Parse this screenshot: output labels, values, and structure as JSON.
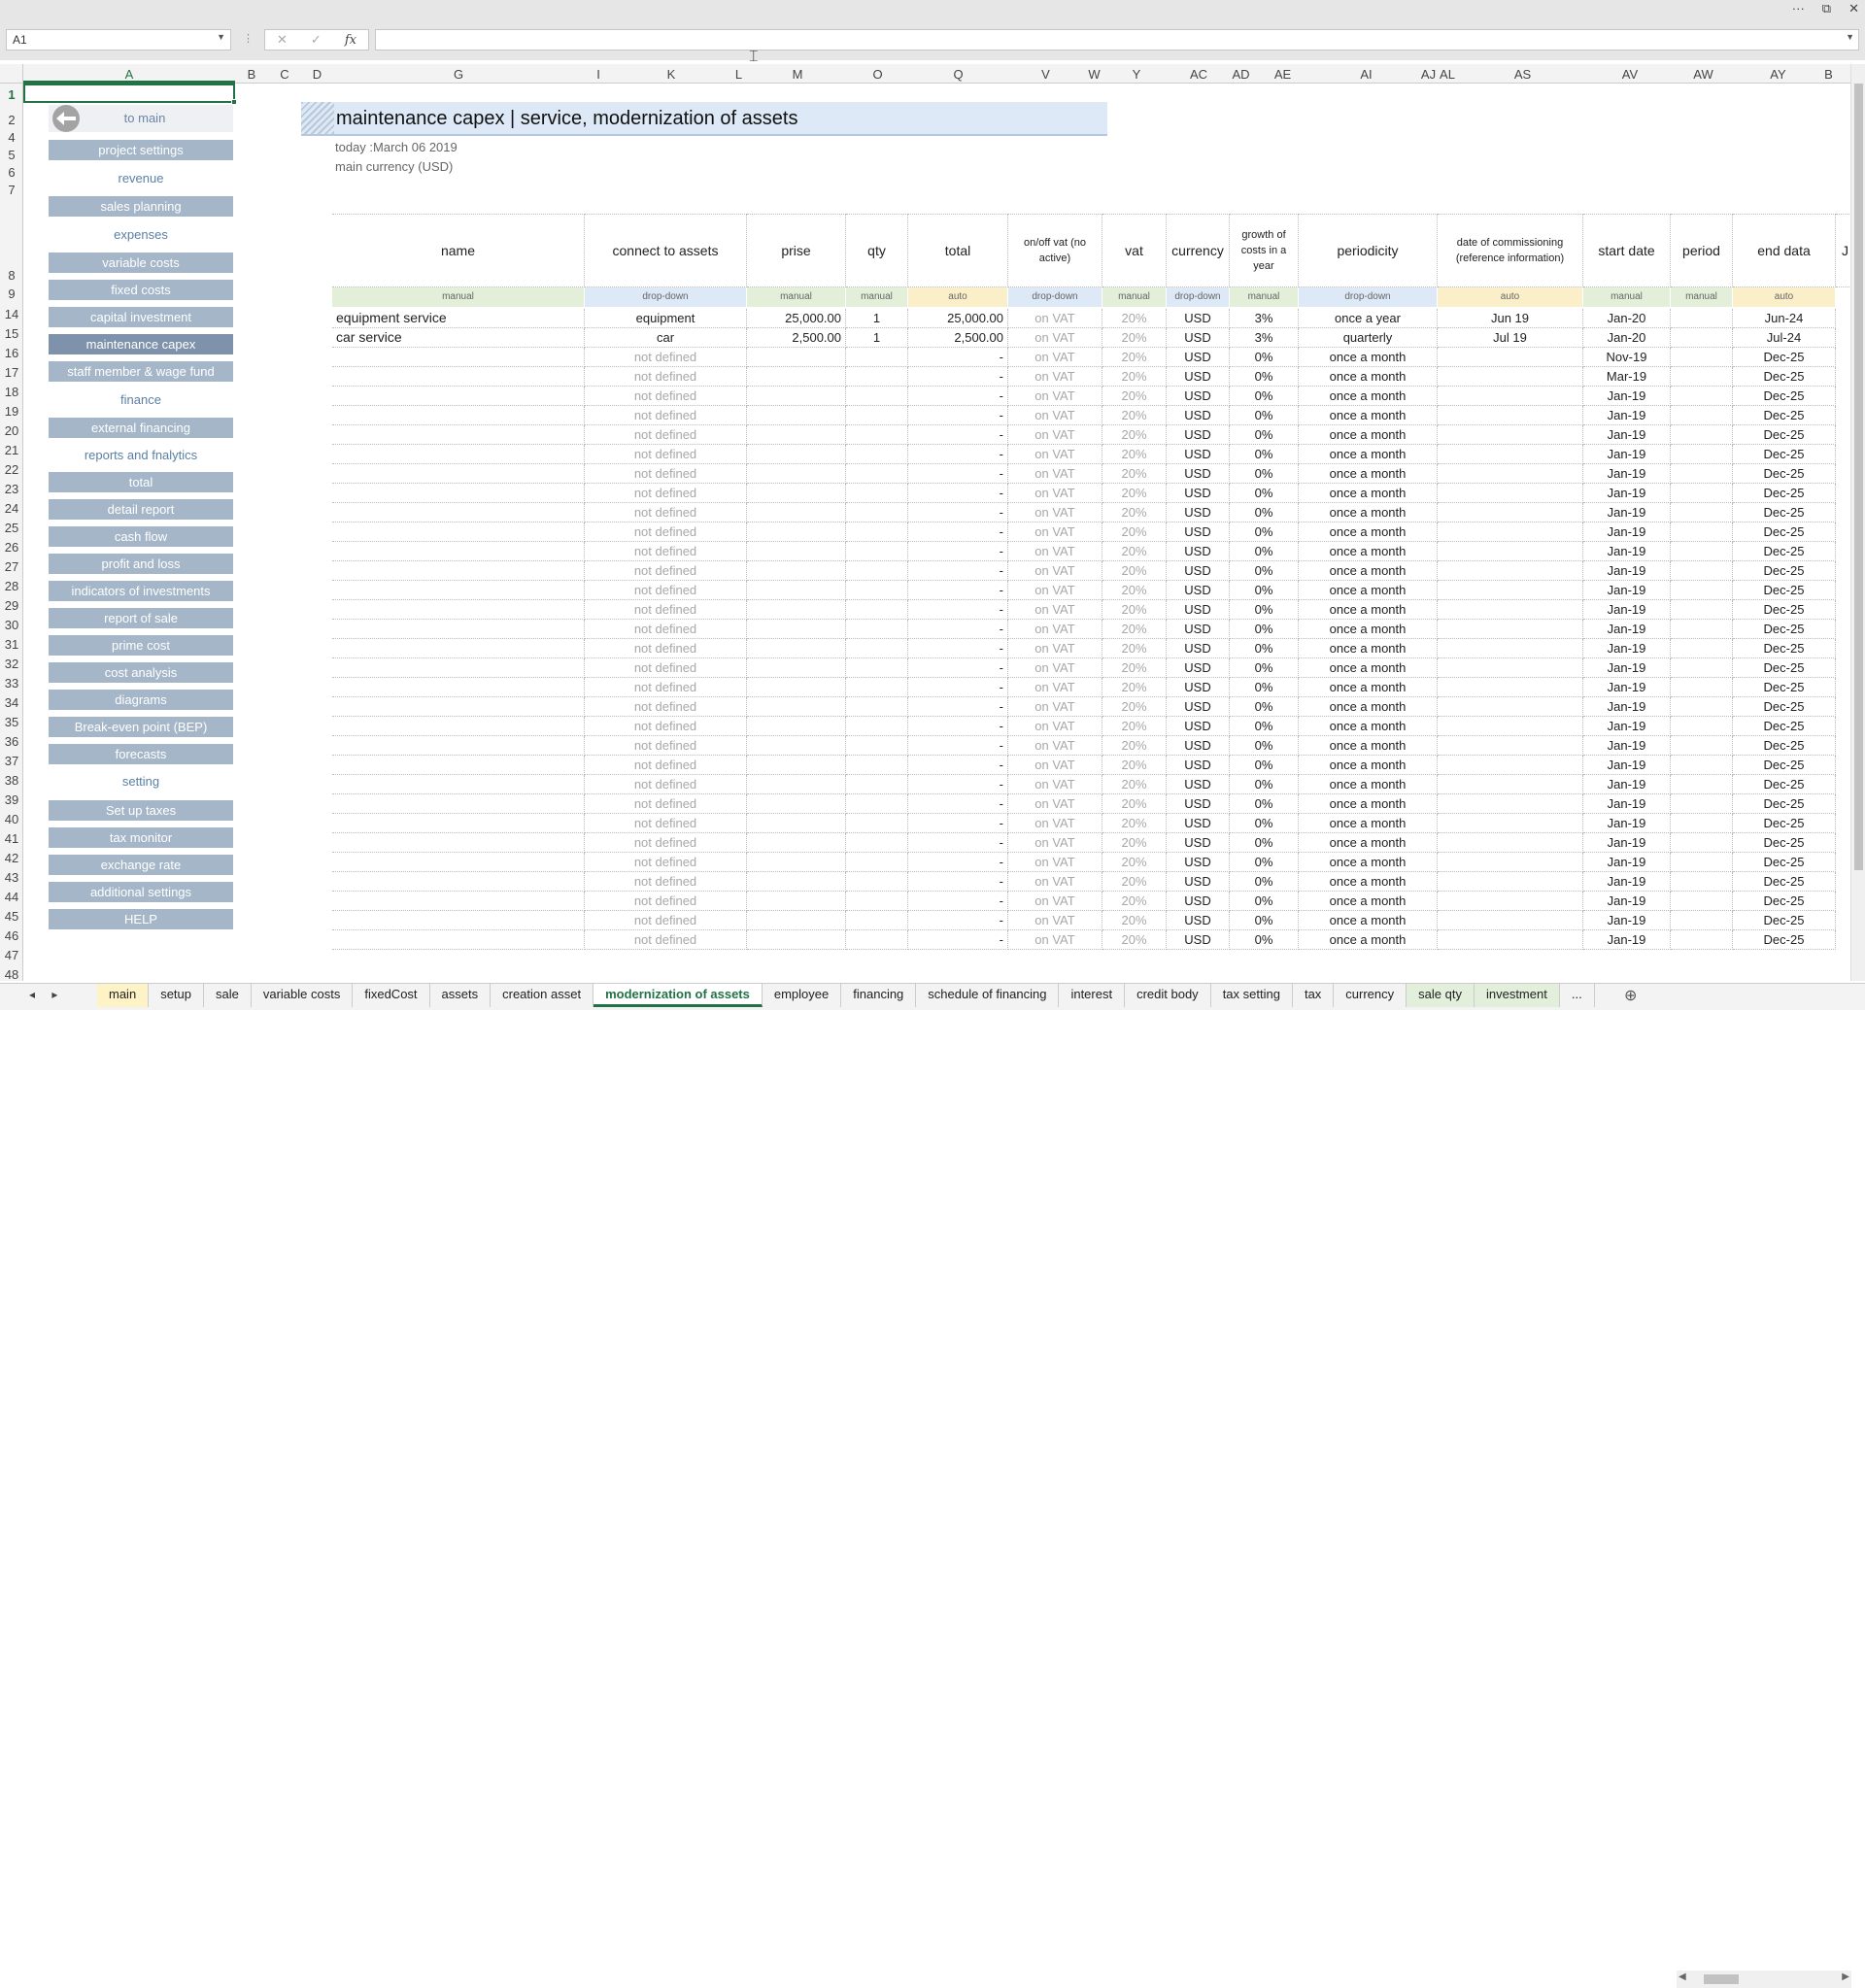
{
  "window": {
    "more": "···",
    "restore": "⧉",
    "close": "✕"
  },
  "formula_bar": {
    "name_box": "A1",
    "cancel": "✕",
    "enter": "✓",
    "fx": "fx",
    "value": ""
  },
  "columns": [
    {
      "label": "A",
      "active": true
    },
    {
      "label": "B"
    },
    {
      "label": "C"
    },
    {
      "label": "D"
    },
    {
      "label": "G"
    },
    {
      "label": "I"
    },
    {
      "label": "K"
    },
    {
      "label": "L"
    },
    {
      "label": "M"
    },
    {
      "label": "O"
    },
    {
      "label": "Q"
    },
    {
      "label": "V"
    },
    {
      "label": "W"
    },
    {
      "label": "Y"
    },
    {
      "label": "AC"
    },
    {
      "label": "AD"
    },
    {
      "label": "AE"
    },
    {
      "label": "AI"
    },
    {
      "label": "AJ"
    },
    {
      "label": "AL"
    },
    {
      "label": "AS"
    },
    {
      "label": "AV"
    },
    {
      "label": "AW"
    },
    {
      "label": "AY"
    },
    {
      "label": "B"
    }
  ],
  "rows": [
    "1",
    "2",
    "4",
    "5",
    "6",
    "7",
    "8",
    "9",
    "14",
    "15",
    "16",
    "17",
    "18",
    "19",
    "20",
    "21",
    "22",
    "23",
    "24",
    "25",
    "26",
    "27",
    "28",
    "29",
    "30",
    "31",
    "32",
    "33",
    "34",
    "35",
    "36",
    "37",
    "38",
    "39",
    "40",
    "41",
    "42",
    "43",
    "44",
    "45",
    "46",
    "47",
    "48"
  ],
  "nav": [
    {
      "label": "to main",
      "kind": "back"
    },
    {
      "label": "project settings",
      "kind": "btn"
    },
    {
      "label": "revenue",
      "kind": "label"
    },
    {
      "label": "sales planning",
      "kind": "btn"
    },
    {
      "label": "expenses",
      "kind": "label"
    },
    {
      "label": "variable costs",
      "kind": "btn"
    },
    {
      "label": "fixed costs",
      "kind": "btn"
    },
    {
      "label": "capital investment",
      "kind": "btn"
    },
    {
      "label": "maintenance capex",
      "kind": "btn",
      "current": true
    },
    {
      "label": "staff member & wage fund",
      "kind": "btn"
    },
    {
      "label": "finance",
      "kind": "label"
    },
    {
      "label": "external financing",
      "kind": "btn"
    },
    {
      "label": "reports and fnalytics",
      "kind": "label"
    },
    {
      "label": "total",
      "kind": "btn"
    },
    {
      "label": "detail report",
      "kind": "btn"
    },
    {
      "label": "cash flow",
      "kind": "btn"
    },
    {
      "label": "profit and loss",
      "kind": "btn"
    },
    {
      "label": "indicators of investments",
      "kind": "btn"
    },
    {
      "label": "report of sale",
      "kind": "btn"
    },
    {
      "label": "prime cost",
      "kind": "btn"
    },
    {
      "label": "cost analysis",
      "kind": "btn"
    },
    {
      "label": "diagrams",
      "kind": "btn"
    },
    {
      "label": "Break-even point (BEP)",
      "kind": "btn"
    },
    {
      "label": "forecasts",
      "kind": "btn"
    },
    {
      "label": "setting",
      "kind": "label"
    },
    {
      "label": "Set up taxes",
      "kind": "btn"
    },
    {
      "label": "tax monitor",
      "kind": "btn"
    },
    {
      "label": "exchange rate",
      "kind": "btn"
    },
    {
      "label": "additional settings",
      "kind": "btn"
    },
    {
      "label": "HELP",
      "kind": "btn"
    }
  ],
  "page": {
    "title": "maintenance capex | service, modernization of assets",
    "today": "today :March 06 2019",
    "currency": "main currency (USD)"
  },
  "table": {
    "headers": [
      "name",
      "connect to assets",
      "prise",
      "qty",
      "total",
      "on/off vat (no active)",
      "vat",
      "currency",
      "growth of costs  in a year",
      "periodicity",
      "date of commissioning (reference information)",
      "start date",
      "period",
      "end data",
      "J"
    ],
    "tags": [
      "manual",
      "drop-down",
      "manual",
      "manual",
      "auto",
      "drop-down",
      "manual",
      "drop-down",
      "manual",
      "drop-down",
      "auto",
      "manual",
      "manual",
      "auto",
      ""
    ],
    "rows": [
      [
        "equipment service",
        "equipment",
        "25,000.00",
        "1",
        "25,000.00",
        "on VAT",
        "20%",
        "USD",
        "3%",
        "once a year",
        "Jun 19",
        "Jan-20",
        "",
        "Jun-24"
      ],
      [
        "car service",
        "car",
        "2,500.00",
        "1",
        "2,500.00",
        "on VAT",
        "20%",
        "USD",
        "3%",
        "quarterly",
        "Jul 19",
        "Jan-20",
        "",
        "Jul-24"
      ],
      [
        "",
        "not defined",
        "",
        "",
        "-",
        "on VAT",
        "20%",
        "USD",
        "0%",
        "once a month",
        "",
        "Nov-19",
        "",
        "Dec-25"
      ],
      [
        "",
        "not defined",
        "",
        "",
        "-",
        "on VAT",
        "20%",
        "USD",
        "0%",
        "once a month",
        "",
        "Mar-19",
        "",
        "Dec-25"
      ],
      [
        "",
        "not defined",
        "",
        "",
        "-",
        "on VAT",
        "20%",
        "USD",
        "0%",
        "once a month",
        "",
        "Jan-19",
        "",
        "Dec-25"
      ],
      [
        "",
        "not defined",
        "",
        "",
        "-",
        "on VAT",
        "20%",
        "USD",
        "0%",
        "once a month",
        "",
        "Jan-19",
        "",
        "Dec-25"
      ],
      [
        "",
        "not defined",
        "",
        "",
        "-",
        "on VAT",
        "20%",
        "USD",
        "0%",
        "once a month",
        "",
        "Jan-19",
        "",
        "Dec-25"
      ],
      [
        "",
        "not defined",
        "",
        "",
        "-",
        "on VAT",
        "20%",
        "USD",
        "0%",
        "once a month",
        "",
        "Jan-19",
        "",
        "Dec-25"
      ],
      [
        "",
        "not defined",
        "",
        "",
        "-",
        "on VAT",
        "20%",
        "USD",
        "0%",
        "once a month",
        "",
        "Jan-19",
        "",
        "Dec-25"
      ],
      [
        "",
        "not defined",
        "",
        "",
        "-",
        "on VAT",
        "20%",
        "USD",
        "0%",
        "once a month",
        "",
        "Jan-19",
        "",
        "Dec-25"
      ],
      [
        "",
        "not defined",
        "",
        "",
        "-",
        "on VAT",
        "20%",
        "USD",
        "0%",
        "once a month",
        "",
        "Jan-19",
        "",
        "Dec-25"
      ],
      [
        "",
        "not defined",
        "",
        "",
        "-",
        "on VAT",
        "20%",
        "USD",
        "0%",
        "once a month",
        "",
        "Jan-19",
        "",
        "Dec-25"
      ],
      [
        "",
        "not defined",
        "",
        "",
        "-",
        "on VAT",
        "20%",
        "USD",
        "0%",
        "once a month",
        "",
        "Jan-19",
        "",
        "Dec-25"
      ],
      [
        "",
        "not defined",
        "",
        "",
        "-",
        "on VAT",
        "20%",
        "USD",
        "0%",
        "once a month",
        "",
        "Jan-19",
        "",
        "Dec-25"
      ],
      [
        "",
        "not defined",
        "",
        "",
        "-",
        "on VAT",
        "20%",
        "USD",
        "0%",
        "once a month",
        "",
        "Jan-19",
        "",
        "Dec-25"
      ],
      [
        "",
        "not defined",
        "",
        "",
        "-",
        "on VAT",
        "20%",
        "USD",
        "0%",
        "once a month",
        "",
        "Jan-19",
        "",
        "Dec-25"
      ],
      [
        "",
        "not defined",
        "",
        "",
        "-",
        "on VAT",
        "20%",
        "USD",
        "0%",
        "once a month",
        "",
        "Jan-19",
        "",
        "Dec-25"
      ],
      [
        "",
        "not defined",
        "",
        "",
        "-",
        "on VAT",
        "20%",
        "USD",
        "0%",
        "once a month",
        "",
        "Jan-19",
        "",
        "Dec-25"
      ],
      [
        "",
        "not defined",
        "",
        "",
        "-",
        "on VAT",
        "20%",
        "USD",
        "0%",
        "once a month",
        "",
        "Jan-19",
        "",
        "Dec-25"
      ],
      [
        "",
        "not defined",
        "",
        "",
        "-",
        "on VAT",
        "20%",
        "USD",
        "0%",
        "once a month",
        "",
        "Jan-19",
        "",
        "Dec-25"
      ],
      [
        "",
        "not defined",
        "",
        "",
        "-",
        "on VAT",
        "20%",
        "USD",
        "0%",
        "once a month",
        "",
        "Jan-19",
        "",
        "Dec-25"
      ],
      [
        "",
        "not defined",
        "",
        "",
        "-",
        "on VAT",
        "20%",
        "USD",
        "0%",
        "once a month",
        "",
        "Jan-19",
        "",
        "Dec-25"
      ],
      [
        "",
        "not defined",
        "",
        "",
        "-",
        "on VAT",
        "20%",
        "USD",
        "0%",
        "once a month",
        "",
        "Jan-19",
        "",
        "Dec-25"
      ],
      [
        "",
        "not defined",
        "",
        "",
        "-",
        "on VAT",
        "20%",
        "USD",
        "0%",
        "once a month",
        "",
        "Jan-19",
        "",
        "Dec-25"
      ],
      [
        "",
        "not defined",
        "",
        "",
        "-",
        "on VAT",
        "20%",
        "USD",
        "0%",
        "once a month",
        "",
        "Jan-19",
        "",
        "Dec-25"
      ],
      [
        "",
        "not defined",
        "",
        "",
        "-",
        "on VAT",
        "20%",
        "USD",
        "0%",
        "once a month",
        "",
        "Jan-19",
        "",
        "Dec-25"
      ],
      [
        "",
        "not defined",
        "",
        "",
        "-",
        "on VAT",
        "20%",
        "USD",
        "0%",
        "once a month",
        "",
        "Jan-19",
        "",
        "Dec-25"
      ],
      [
        "",
        "not defined",
        "",
        "",
        "-",
        "on VAT",
        "20%",
        "USD",
        "0%",
        "once a month",
        "",
        "Jan-19",
        "",
        "Dec-25"
      ],
      [
        "",
        "not defined",
        "",
        "",
        "-",
        "on VAT",
        "20%",
        "USD",
        "0%",
        "once a month",
        "",
        "Jan-19",
        "",
        "Dec-25"
      ],
      [
        "",
        "not defined",
        "",
        "",
        "-",
        "on VAT",
        "20%",
        "USD",
        "0%",
        "once a month",
        "",
        "Jan-19",
        "",
        "Dec-25"
      ],
      [
        "",
        "not defined",
        "",
        "",
        "-",
        "on VAT",
        "20%",
        "USD",
        "0%",
        "once a month",
        "",
        "Jan-19",
        "",
        "Dec-25"
      ],
      [
        "",
        "not defined",
        "",
        "",
        "-",
        "on VAT",
        "20%",
        "USD",
        "0%",
        "once a month",
        "",
        "Jan-19",
        "",
        "Dec-25"
      ],
      [
        "",
        "not defined",
        "",
        "",
        "-",
        "on VAT",
        "20%",
        "USD",
        "0%",
        "once a month",
        "",
        "Jan-19",
        "",
        "Dec-25"
      ]
    ]
  },
  "sheet_tabs": [
    {
      "label": "main",
      "style": "yellow"
    },
    {
      "label": "setup"
    },
    {
      "label": "sale"
    },
    {
      "label": "variable costs"
    },
    {
      "label": "fixedCost"
    },
    {
      "label": "assets"
    },
    {
      "label": "creation asset"
    },
    {
      "label": "modernization of assets",
      "style": "active"
    },
    {
      "label": "employee"
    },
    {
      "label": "financing"
    },
    {
      "label": "schedule of financing"
    },
    {
      "label": "interest"
    },
    {
      "label": "credit body"
    },
    {
      "label": "tax setting"
    },
    {
      "label": "tax"
    },
    {
      "label": "currency"
    },
    {
      "label": "sale qty",
      "style": "green"
    },
    {
      "label": "investment",
      "style": "green"
    },
    {
      "label": "..."
    }
  ],
  "tab_nav": {
    "prev": "◂",
    "next": "▸"
  },
  "add_sheet": "⊕",
  "accent": "#217346"
}
